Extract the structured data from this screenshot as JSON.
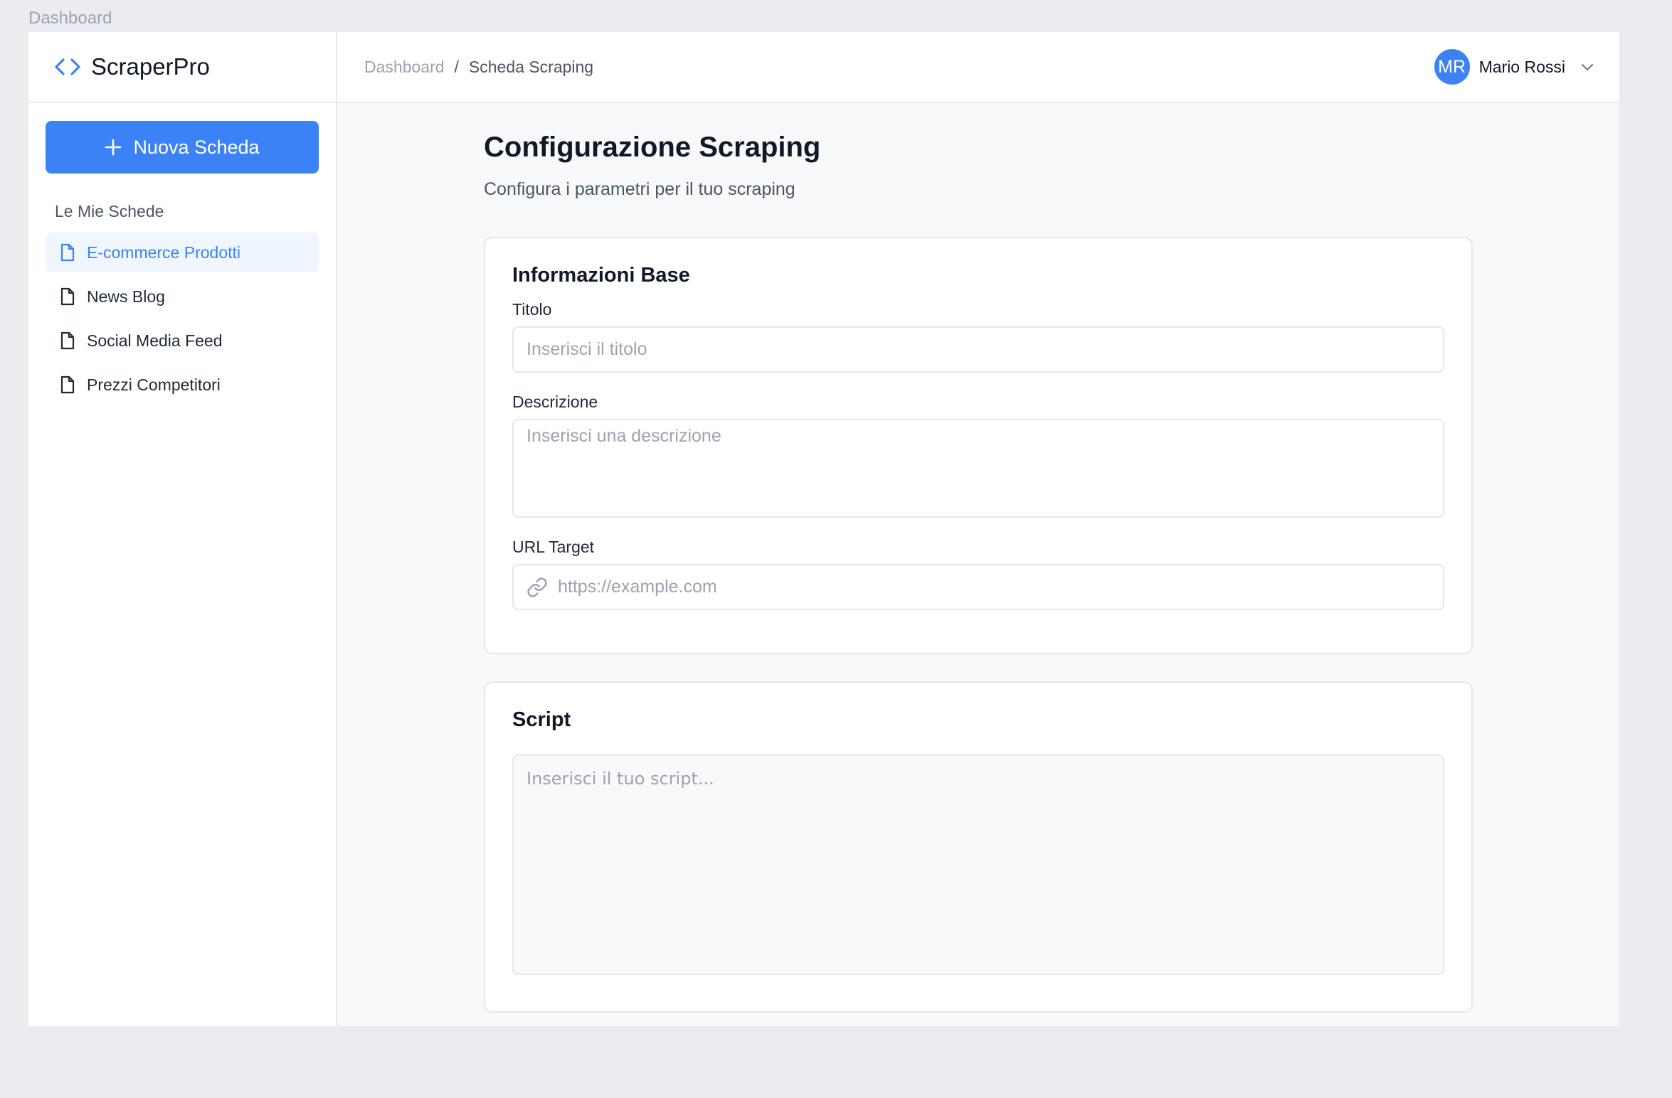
{
  "window": {
    "label": "Dashboard"
  },
  "brand": {
    "name": "ScraperPro",
    "icon": "code-icon"
  },
  "sidebar": {
    "new_button_label": "Nuova Scheda",
    "section_title": "Le Mie Schede",
    "items": [
      {
        "label": "E-commerce Prodotti",
        "active": true,
        "icon": "document-icon"
      },
      {
        "label": "News Blog",
        "active": false,
        "icon": "document-icon"
      },
      {
        "label": "Social Media Feed",
        "active": false,
        "icon": "document-icon"
      },
      {
        "label": "Prezzi Competitori",
        "active": false,
        "icon": "document-icon"
      }
    ]
  },
  "header": {
    "breadcrumb": {
      "root": "Dashboard",
      "separator": "/",
      "current": "Scheda Scraping"
    },
    "user": {
      "initials": "MR",
      "name": "Mario Rossi"
    }
  },
  "page": {
    "title": "Configurazione Scraping",
    "subtitle": "Configura i parametri per il tuo scraping"
  },
  "form": {
    "section_title": "Informazioni Base",
    "title_label": "Titolo",
    "title_placeholder": "Inserisci il titolo",
    "description_label": "Descrizione",
    "description_placeholder": "Inserisci una descrizione",
    "url_label": "URL Target",
    "url_placeholder": "https://example.com"
  },
  "script": {
    "section_title": "Script",
    "placeholder": "Inserisci il tuo script..."
  },
  "colors": {
    "accent": "#3b82f6",
    "active_bg": "#eff6ff",
    "page_bg": "#f8f9fb",
    "border": "#e5e7eb"
  }
}
